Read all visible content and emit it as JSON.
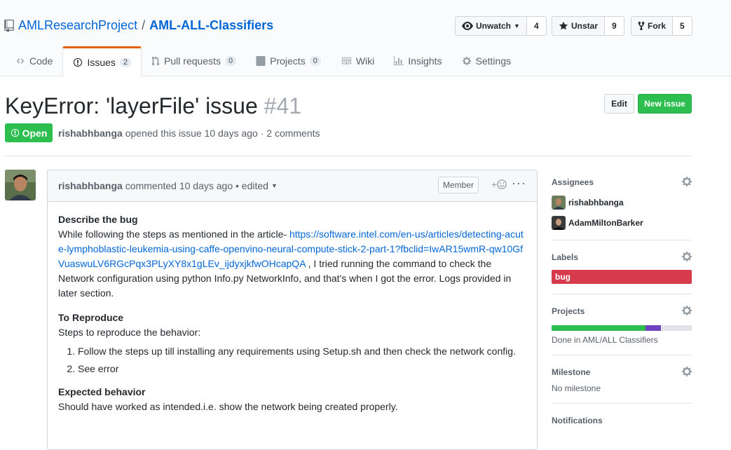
{
  "repo": {
    "owner": "AMLResearchProject",
    "separator": "/",
    "name": "AML-ALL-Classifiers"
  },
  "actions": [
    {
      "label": "Unwatch",
      "icon": "eye-icon",
      "count": "4"
    },
    {
      "label": "Unstar",
      "icon": "star-icon",
      "count": "9"
    },
    {
      "label": "Fork",
      "icon": "fork-icon",
      "count": "5"
    }
  ],
  "tabs": [
    {
      "label": "Code",
      "icon": "code-icon",
      "counter": null
    },
    {
      "label": "Issues",
      "icon": "issue-icon",
      "counter": "2",
      "selected": true
    },
    {
      "label": "Pull requests",
      "icon": "pull-request-icon",
      "counter": "0"
    },
    {
      "label": "Projects",
      "icon": "project-icon",
      "counter": "0"
    },
    {
      "label": "Wiki",
      "icon": "book-icon",
      "counter": null
    },
    {
      "label": "Insights",
      "icon": "graph-icon",
      "counter": null
    },
    {
      "label": "Settings",
      "icon": "gear-icon",
      "counter": null
    }
  ],
  "issue": {
    "title": "KeyError: 'layerFile' issue",
    "number": "#41",
    "state": "Open",
    "author": "rishabhbanga",
    "meta": "opened this issue 10 days ago · 2 comments",
    "edit_label": "Edit",
    "new_issue_label": "New issue"
  },
  "comment": {
    "author": "rishabhbanga",
    "meta": "commented 10 days ago • edited",
    "role": "Member",
    "describe_heading": "Describe the bug",
    "describe_text_1": "While following the steps as mentioned in the article- ",
    "describe_link": "https://software.intel.com/en-us/articles/detecting-acute-lymphoblastic-leukemia-using-caffe-openvino-neural-compute-stick-2-part-1?fbclid=IwAR15wmR-qw10GfVuaswuLV6RGcPqx3PLyXY8x1gLEv_ijdyxjkfwOHcapQA",
    "describe_text_2": " , I tried running the command to check the Network configuration using python Info.py NetworkInfo, and that's when I got the error. Logs provided in later section.",
    "reproduce_heading": "To Reproduce",
    "reproduce_text": "Steps to reproduce the behavior:",
    "steps": [
      "Follow the steps up till installing any requirements using Setup.sh and then check the network config.",
      "See error"
    ],
    "expected_heading": "Expected behavior",
    "expected_text": "Should have worked as intended.i.e. show the network being created properly."
  },
  "sidebar": {
    "assignees_title": "Assignees",
    "assignees": [
      "rishabhbanga",
      "AdamMiltonBarker"
    ],
    "labels_title": "Labels",
    "label": "bug",
    "label_color": "#d73a4a",
    "projects_title": "Projects",
    "project_progress": {
      "done": 0.67,
      "in_progress": 0.11
    },
    "project_text": "Done in AML/ALL Classifiers",
    "milestone_title": "Milestone",
    "milestone_text": "No milestone",
    "notifications_title": "Notifications"
  }
}
